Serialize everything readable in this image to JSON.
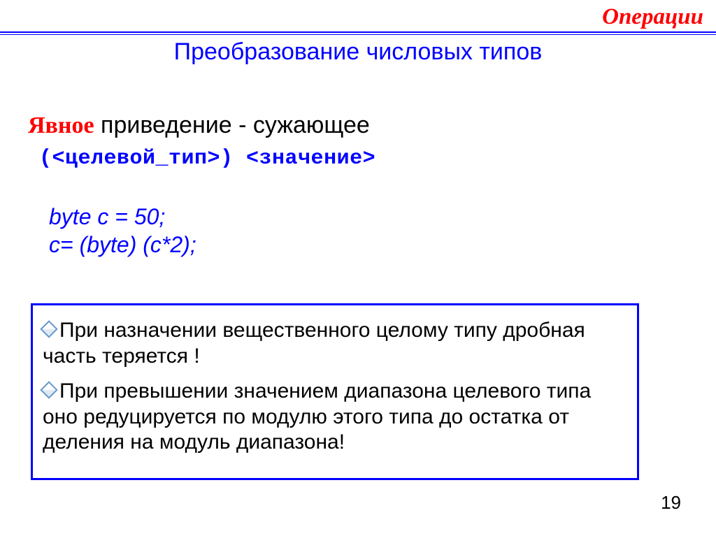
{
  "header": {
    "title": "Операции"
  },
  "subtitle": "Преобразование числовых типов",
  "explicit": {
    "keyword": "Явное",
    "rest": " приведение - сужающее"
  },
  "syntax": "(<целевой_тип>) <значение>",
  "code": {
    "l1": "byte c = 50;",
    "l2": "c= (byte) (c*2);"
  },
  "notes": {
    "n1": "При назначении вещественного целому типу дробная часть теряется !",
    "n2": "При превышении значением диапазона целевого типа оно редуцируется по модулю этого типа до остатка от деления на модуль диапазона!"
  },
  "page": "19"
}
